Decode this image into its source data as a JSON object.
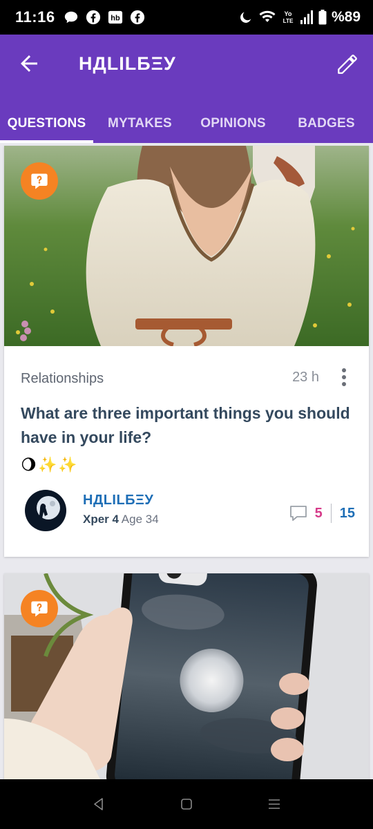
{
  "status_bar": {
    "time": "11:16",
    "notification_icons": [
      "chat-icon",
      "facebook-icon",
      "hb-icon",
      "facebook-icon"
    ],
    "hb_label": "hb",
    "network_label_top": "Yo",
    "network_label_bottom": "LTE",
    "battery": "%89"
  },
  "app_bar": {
    "title": "НДLILБΞУ",
    "tabs": [
      {
        "label": "QUESTIONS",
        "active": true
      },
      {
        "label": "MYTAKES",
        "active": false
      },
      {
        "label": "OPINIONS",
        "active": false
      },
      {
        "label": "BADGES",
        "active": false
      }
    ]
  },
  "posts": [
    {
      "category": "Relationships",
      "time": "23 h",
      "question": "What are three important things you should have in your life?",
      "emojis": [
        "🌖",
        "✨",
        "✨"
      ],
      "author": "НДLILБΞУ",
      "xper": "Xper 4",
      "age": "Age 34",
      "opinions": "5",
      "views": "15"
    }
  ],
  "colors": {
    "appbar": "#6a3bbe",
    "badge_orange": "#f58323",
    "author_blue": "#1e6eb6",
    "opinions_pink": "#d63b8a",
    "question_text": "#34495e"
  }
}
